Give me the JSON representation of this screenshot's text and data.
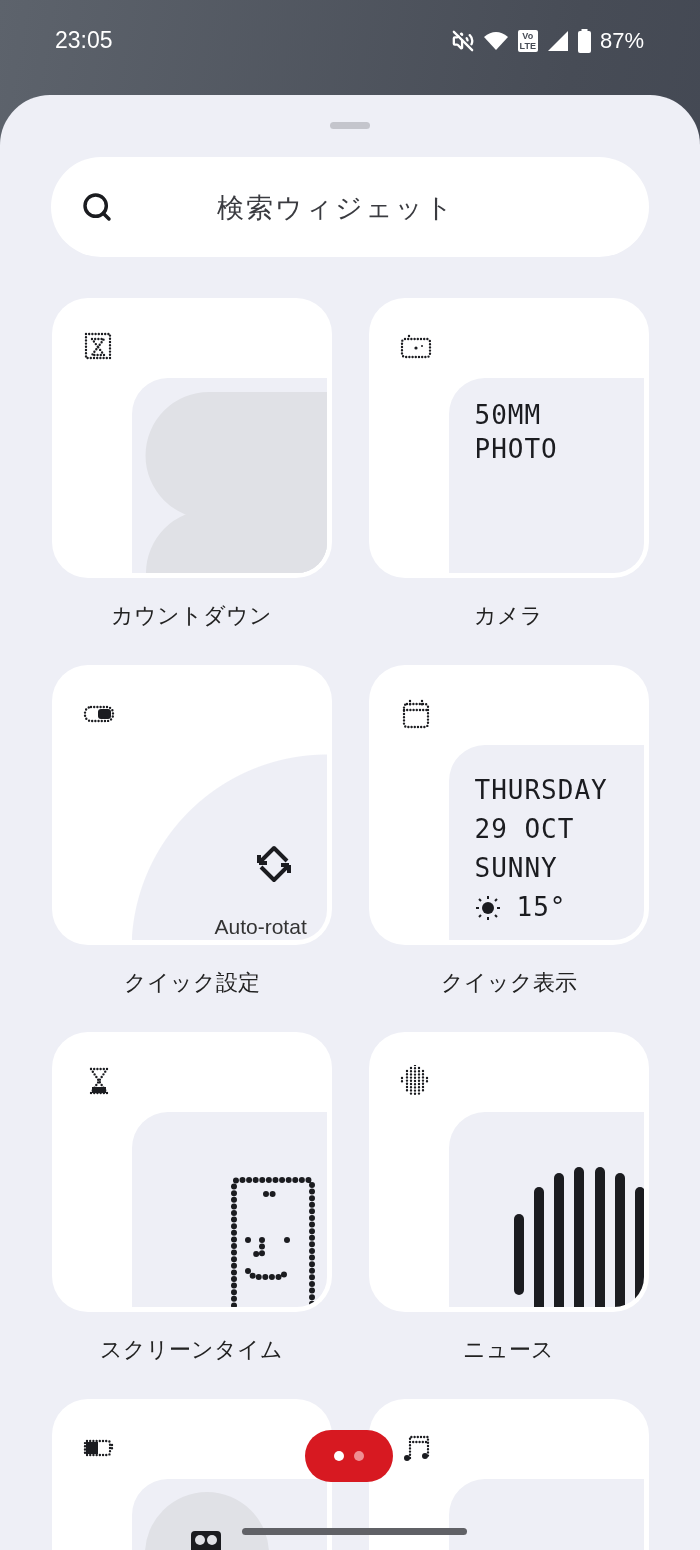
{
  "status_bar": {
    "time": "23:05",
    "volte": [
      "Vo",
      "LTE"
    ],
    "battery": "87%"
  },
  "search": {
    "placeholder": "検索ウィジェット"
  },
  "widgets": [
    {
      "kind": "countdown",
      "name": "カウントダウン"
    },
    {
      "kind": "camera",
      "name": "カメラ",
      "lines": [
        "50MM",
        "PHOTO"
      ]
    },
    {
      "kind": "quick_settings",
      "name": "クイック設定",
      "caption": "Auto-rotat"
    },
    {
      "kind": "quick_view",
      "name": "クイック表示",
      "lines": [
        "THURSDAY",
        "29 OCT",
        "SUNNY"
      ],
      "temperature": "15°"
    },
    {
      "kind": "screen_time",
      "name": "スクリーンタイム"
    },
    {
      "kind": "news",
      "name": "ニュース"
    },
    {
      "kind": "battery"
    },
    {
      "kind": "music"
    }
  ],
  "pager": [
    {
      "selected": true
    },
    {
      "selected": false
    }
  ]
}
